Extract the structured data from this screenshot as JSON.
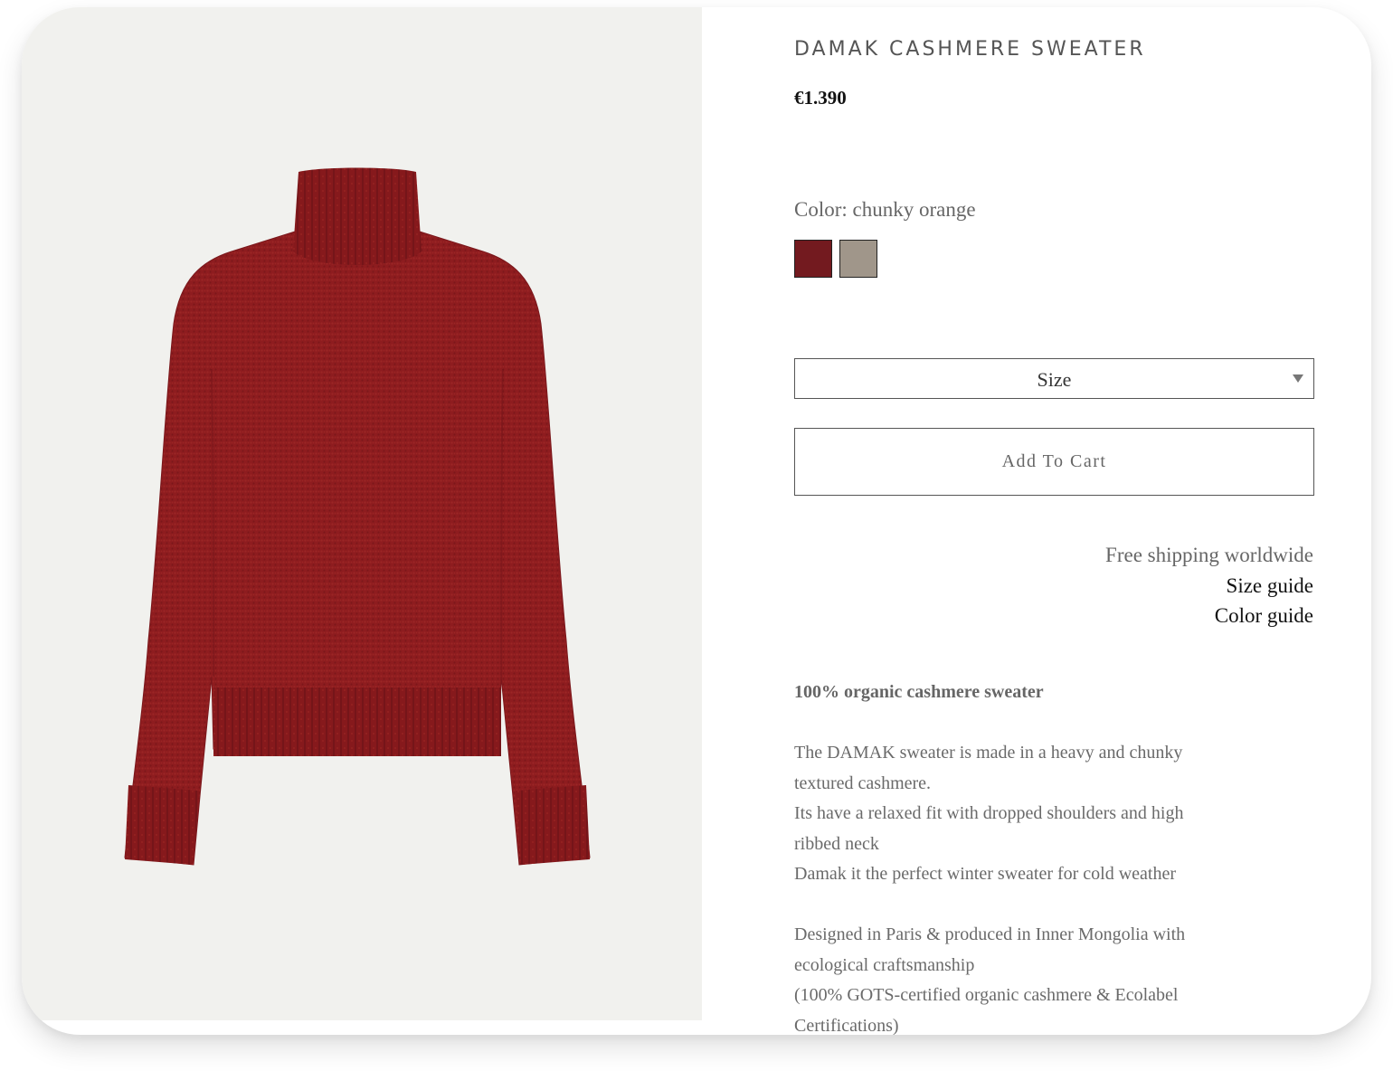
{
  "product": {
    "title": "DAMAK CASHMERE SWEATER",
    "price": "€1.390",
    "image_alt": "red chunky knit turtleneck sweater"
  },
  "color": {
    "label": "Color: chunky orange",
    "swatches": [
      {
        "name": "chunky orange",
        "hex": "#731a1f"
      },
      {
        "name": "grey",
        "hex": "#a0968a"
      }
    ]
  },
  "size_select": {
    "label": "Size"
  },
  "cart": {
    "add_label": "Add To Cart"
  },
  "info_links": {
    "free_shipping": "Free shipping worldwide",
    "size_guide": "Size guide",
    "color_guide": "Color guide"
  },
  "description": {
    "heading": "100% organic cashmere sweater",
    "paragraph1": [
      "The DAMAK sweater is made in a heavy and chunky",
      "textured cashmere.",
      "Its have a relaxed fit with dropped shoulders and high",
      "ribbed neck",
      "Damak it the perfect winter sweater for cold weather"
    ],
    "paragraph2": [
      "Designed in Paris & produced in Inner Mongolia with",
      "ecological craftsmanship",
      "(100% GOTS-certified organic cashmere & Ecolabel",
      "Certifications)"
    ]
  },
  "colors": {
    "sweater": "#8e1c1f",
    "image_bg": "#f1f1ee"
  }
}
